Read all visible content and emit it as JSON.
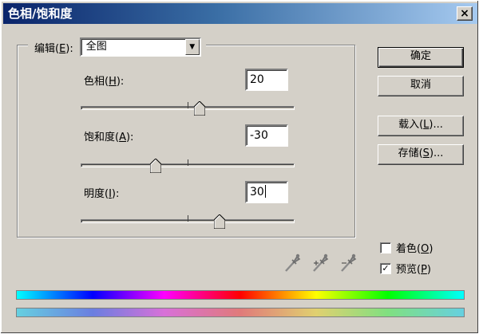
{
  "window": {
    "title": "色相/饱和度",
    "close_glyph": "×"
  },
  "edit": {
    "label_pre": "编辑(",
    "label_key": "E",
    "label_post": "):",
    "selected": "全图"
  },
  "sliders": [
    {
      "label_pre": "色相(",
      "label_key": "H",
      "label_post": "):",
      "value": "20",
      "min": -180,
      "max": 180
    },
    {
      "label_pre": "饱和度(",
      "label_key": "A",
      "label_post": "):",
      "value": "-30",
      "min": -100,
      "max": 100
    },
    {
      "label_pre": "明度(",
      "label_key": "I",
      "label_post": "):",
      "value": "30",
      "min": -100,
      "max": 100
    }
  ],
  "buttons": {
    "ok": "确定",
    "cancel": "取消",
    "load_pre": "载入(",
    "load_key": "L",
    "load_post": ")...",
    "save_pre": "存储(",
    "save_key": "S",
    "save_post": ")..."
  },
  "checkboxes": {
    "colorize": {
      "pre": "着色(",
      "key": "O",
      "post": ")",
      "checked": false
    },
    "preview": {
      "pre": "预览(",
      "key": "P",
      "post": ")",
      "checked": true
    },
    "check_glyph": "✓"
  },
  "icons": [
    "eyedropper-icon",
    "eyedropper-plus-icon",
    "eyedropper-minus-icon"
  ],
  "colors": {
    "title_start": "#0a246a",
    "title_end": "#a6caf0",
    "dialog_bg": "#d4d0c8"
  }
}
